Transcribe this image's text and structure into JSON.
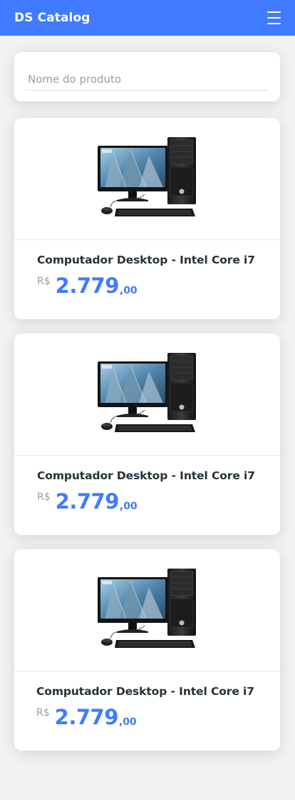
{
  "navbar": {
    "brand": "DS Catalog",
    "menu_icon": "hamburger-menu-icon",
    "color": "#407bff"
  },
  "search": {
    "placeholder": "Nome do produto",
    "value": ""
  },
  "products": [
    {
      "name": "Computador Desktop - Intel Core i7",
      "currency": "R$",
      "price_int": "2.779",
      "price_dec": ",00",
      "image": "desktop-computer-image"
    },
    {
      "name": "Computador Desktop - Intel Core i7",
      "currency": "R$",
      "price_int": "2.779",
      "price_dec": ",00",
      "image": "desktop-computer-image"
    },
    {
      "name": "Computador Desktop - Intel Core i7",
      "currency": "R$",
      "price_int": "2.779",
      "price_dec": ",00",
      "image": "desktop-computer-image"
    }
  ],
  "colors": {
    "accent": "#407bff",
    "background": "#f2f2f2",
    "text": "#263238",
    "muted": "#9e9e9e"
  }
}
